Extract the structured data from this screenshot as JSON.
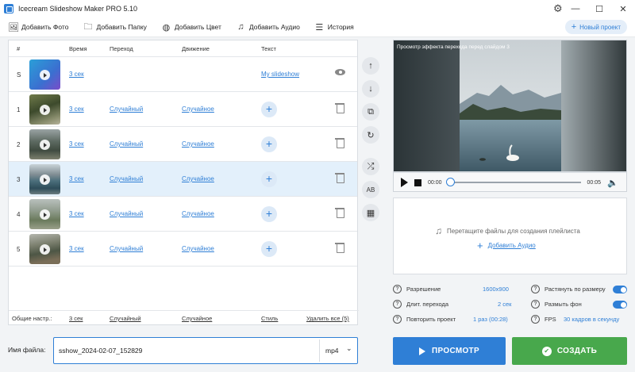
{
  "window": {
    "title": "Icecream Slideshow Maker PRO 5.10",
    "controls": [
      "—",
      "☐",
      "✕"
    ]
  },
  "toolbar": {
    "items": [
      {
        "label": "Добавить Фото",
        "icon": "add-photo-icon"
      },
      {
        "label": "Добавить Папку",
        "icon": "add-folder-icon"
      },
      {
        "label": "Добавить Цвет",
        "icon": "palette-icon"
      },
      {
        "label": "Добавить Аудио",
        "icon": "add-audio-icon"
      },
      {
        "label": "История",
        "icon": "menu-icon"
      }
    ],
    "new_project": "Новый проект"
  },
  "table": {
    "headers": {
      "num": "#",
      "time": "Время",
      "transition": "Переход",
      "motion": "Движение",
      "text": "Текст"
    },
    "rows": [
      {
        "num": "S",
        "time": "3 сек",
        "transition": "",
        "motion": "",
        "text": "My slideshow",
        "kind": "title"
      },
      {
        "num": "1",
        "time": "3 сек",
        "transition": "Случайный",
        "motion": "Случайное",
        "text": "+",
        "kind": "slide"
      },
      {
        "num": "2",
        "time": "3 сек",
        "transition": "Случайный",
        "motion": "Случайное",
        "text": "+",
        "kind": "slide"
      },
      {
        "num": "3",
        "time": "3 сек",
        "transition": "Случайный",
        "motion": "Случайное",
        "text": "+",
        "kind": "slide",
        "selected": true
      },
      {
        "num": "4",
        "time": "3 сек",
        "transition": "Случайный",
        "motion": "Случайное",
        "text": "+",
        "kind": "slide"
      },
      {
        "num": "5",
        "time": "3 сек",
        "transition": "Случайный",
        "motion": "Случайное",
        "text": "+",
        "kind": "slide"
      }
    ],
    "footer": {
      "label": "Общие настр.:",
      "time": "3 сек",
      "transition": "Случайный",
      "motion": "Случайное",
      "style": "Стиль",
      "delete_all": "Удалить все (5)"
    }
  },
  "side_tools": [
    "move-up-icon",
    "move-down-icon",
    "crop-icon",
    "rotate-icon",
    "shuffle-icon",
    "text-style-icon",
    "film-icon"
  ],
  "preview": {
    "caption": "Просмотр эффекта перехода перед слайдом 3",
    "time_current": "00:00",
    "time_total": "00:05",
    "progress": 0
  },
  "audio": {
    "hint": "Перетащите файлы для создания плейлиста",
    "add_label": "Добавить Аудио"
  },
  "settings": {
    "resolution_label": "Разрешение",
    "resolution_value": "1600x900",
    "transition_length_label": "Длит. перехода",
    "transition_length_value": "2 сек",
    "repeat_label": "Повторить проект",
    "repeat_value": "1 раз (00:28)",
    "stretch_label": "Растянуть по размеру",
    "stretch_on": true,
    "blur_label": "Размыть фон",
    "blur_on": true,
    "fps_label": "FPS",
    "fps_value": "30 кадров в секунду"
  },
  "output": {
    "filename_label": "Имя файла:",
    "filename_value": "sshow_2024-02-07_152829",
    "format": "mp4"
  },
  "actions": {
    "preview": "ПРОСМОТР",
    "create": "СОЗДАТЬ"
  },
  "colors": {
    "accent": "#2f7fd6",
    "create": "#48a84c",
    "selected_row": "#e3f0fb"
  }
}
